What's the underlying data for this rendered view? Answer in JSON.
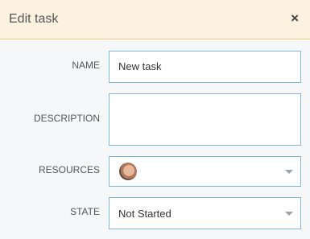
{
  "dialog": {
    "title": "Edit task",
    "close_glyph": "×"
  },
  "form": {
    "name": {
      "label": "NAME",
      "value": "New task"
    },
    "description": {
      "label": "DESCRIPTION",
      "value": ""
    },
    "resources": {
      "label": "RESOURCES",
      "avatar_icon": "user-avatar"
    },
    "state": {
      "label": "STATE",
      "value": "Not Started"
    }
  },
  "colors": {
    "header_bg": "#fdf2e0",
    "header_border": "#f0c97a",
    "field_border": "#7fb7d8",
    "body_bg": "#f5f7f9"
  }
}
